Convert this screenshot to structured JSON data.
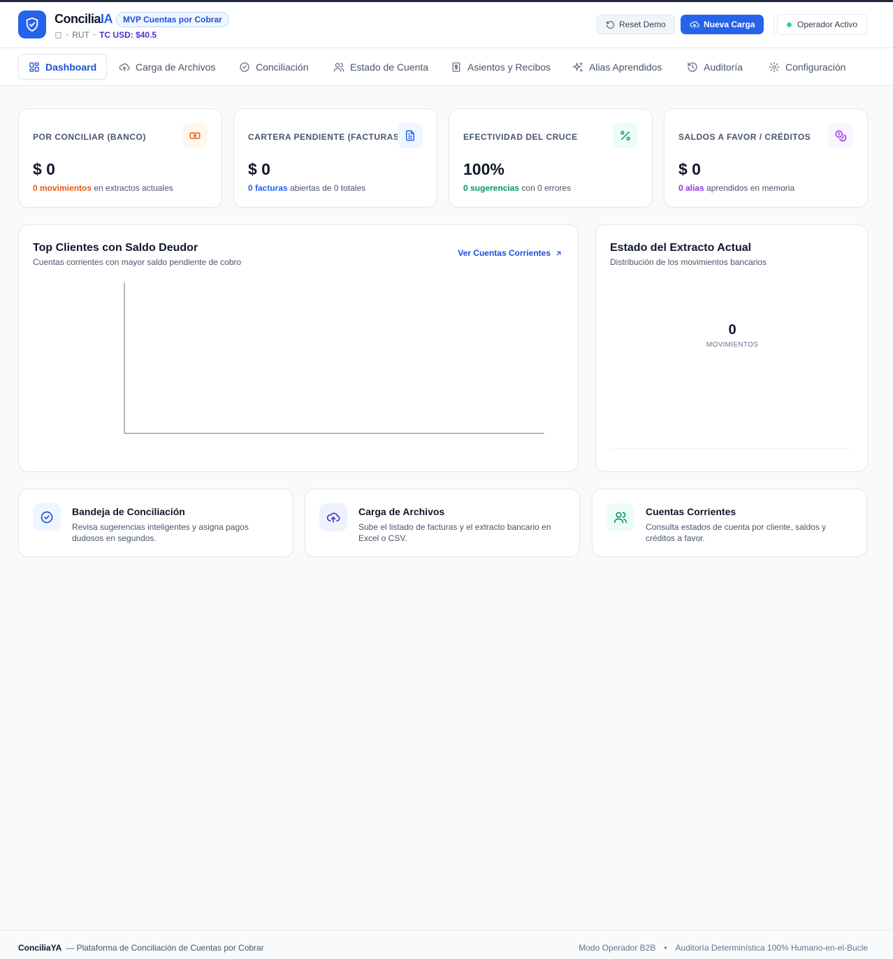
{
  "app": {
    "brand_prefix": "Concilia",
    "brand_accent": "IA",
    "badge": "MVP Cuentas por Cobrar",
    "rut_label": "RUT",
    "tc_usd": "TC USD: $40.5",
    "reset_label": "Reset Demo",
    "new_upload_label": "Nueva Carga",
    "operator_label": "Operador Activo"
  },
  "nav": {
    "items": [
      {
        "label": "Dashboard",
        "icon": "layout-grid-icon",
        "active": true
      },
      {
        "label": "Carga de Archivos",
        "icon": "cloud-upload-icon"
      },
      {
        "label": "Conciliación",
        "icon": "check-circle-icon"
      },
      {
        "label": "Estado de Cuenta",
        "icon": "users-icon"
      },
      {
        "label": "Asientos y Recibos",
        "icon": "receipt-icon"
      },
      {
        "label": "Alias Aprendidos",
        "icon": "sparkles-icon"
      },
      {
        "label": "Auditoría",
        "icon": "history-icon"
      },
      {
        "label": "Configuración",
        "icon": "gear-icon"
      }
    ]
  },
  "kpis": [
    {
      "label": "Por Conciliar (Banco)",
      "value": "$ 0",
      "foot_strong": "0 movimientos",
      "foot_rest": "en extractos actuales",
      "color": "#ea580c",
      "icon": "banknote-icon"
    },
    {
      "label": "Cartera Pendiente (Facturas)",
      "value": "$ 0",
      "foot_strong": "0 facturas",
      "foot_rest": "abiertas de 0 totales",
      "color": "#2563eb",
      "icon": "file-text-icon"
    },
    {
      "label": "Efectividad del Cruce",
      "value": "100%",
      "foot_strong": "0 sugerencias",
      "foot_rest": "con 0 errores",
      "color": "#059669",
      "icon": "percent-icon"
    },
    {
      "label": "Saldos a Favor / Créditos",
      "value": "$ 0",
      "foot_strong": "0 alias",
      "foot_rest": "aprendidos en memoria",
      "color": "#9333ea",
      "icon": "coins-icon"
    }
  ],
  "top_clients": {
    "title": "Top Clientes con Saldo Deudor",
    "subtitle": "Cuentas corrientes con mayor saldo pendiente de cobro",
    "link": "Ver Cuentas Corrientes"
  },
  "statement": {
    "title": "Estado del Extracto Actual",
    "subtitle": "Distribución de los movimientos bancarios",
    "center_value": "0",
    "center_label": "MOVIMIENTOS"
  },
  "shortcuts": [
    {
      "title": "Bandeja de Conciliación",
      "desc": "Revisa sugerencias inteligentes y asigna pagos dudosos en segundos.",
      "icon": "check-circle-icon",
      "color": "#1d4ed8",
      "bg": "#eff6ff"
    },
    {
      "title": "Carga de Archivos",
      "desc": "Sube el listado de facturas y el extracto bancario en Excel o CSV.",
      "icon": "cloud-upload-icon",
      "color": "#4338ca",
      "bg": "#eef2ff"
    },
    {
      "title": "Cuentas Corrientes",
      "desc": "Consulta estados de cuenta por cliente, saldos y créditos a favor.",
      "icon": "users-icon",
      "color": "#059669",
      "bg": "#ecfdf5"
    }
  ],
  "footer": {
    "brand": "ConciliaYA",
    "tagline": "— Plataforma de Conciliación de Cuentas por Cobrar",
    "mode": "Modo Operador B2B",
    "separator": "•",
    "audit": "Auditoría Determinística 100% Humano-en-el-Bucle"
  }
}
